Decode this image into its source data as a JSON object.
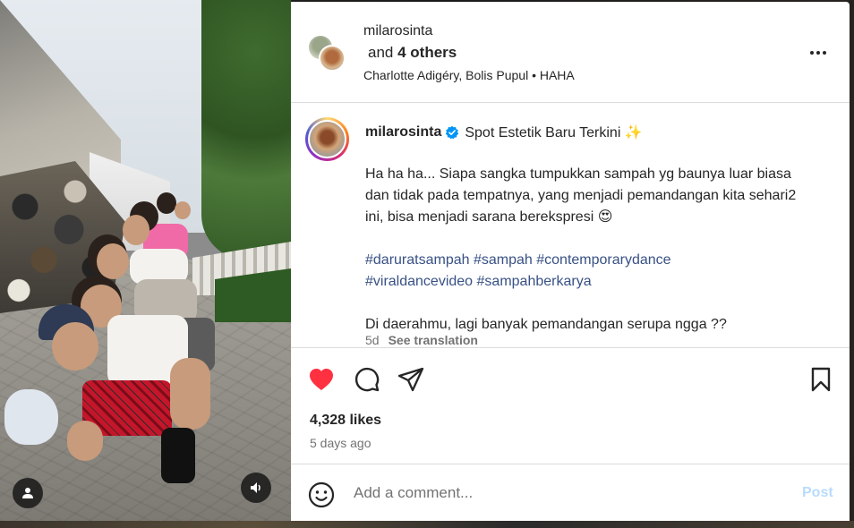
{
  "header": {
    "username": "milarosinta",
    "others_prefix": "and ",
    "others_count": "4 others",
    "audio": "Charlotte Adigéry, Bolis Pupul • HAHA"
  },
  "caption": {
    "username": "milarosinta",
    "title": "Spot Estetik Baru Terkini ✨",
    "paragraph1": "Ha ha ha... Siapa sangka tumpukkan sampah yg baunya luar biasa dan tidak pada tempatnya, yang menjadi pemandangan kita sehari2 ini, bisa menjadi sarana berekspresi 😍",
    "hashtags_line1": [
      "#daruratsampah",
      "#sampah",
      "#contemporarydance"
    ],
    "hashtags_line2": [
      "#viraldancevideo",
      "#sampahberkarya"
    ],
    "paragraph2": "Di daerahmu, lagi banyak pemandangan serupa ngga ??",
    "age": "5d",
    "see_translation": "See translation"
  },
  "actions": {
    "likes": "4,328 likes",
    "posted": "5 days ago",
    "liked": true
  },
  "comment": {
    "placeholder": "Add a comment...",
    "post_label": "Post"
  },
  "icons": {
    "user": "user-tag-icon",
    "sound": "speaker-icon",
    "more": "more-horizontal-icon",
    "heart": "heart-icon",
    "comment": "comment-icon",
    "share": "paper-plane-icon",
    "save": "bookmark-icon",
    "emoji": "emoji-icon",
    "verified": "verified-badge-icon"
  },
  "colors": {
    "heart": "#ff3040",
    "verified": "#0095f6",
    "hashtag": "#385185",
    "post_disabled": "#b8dcfc"
  }
}
